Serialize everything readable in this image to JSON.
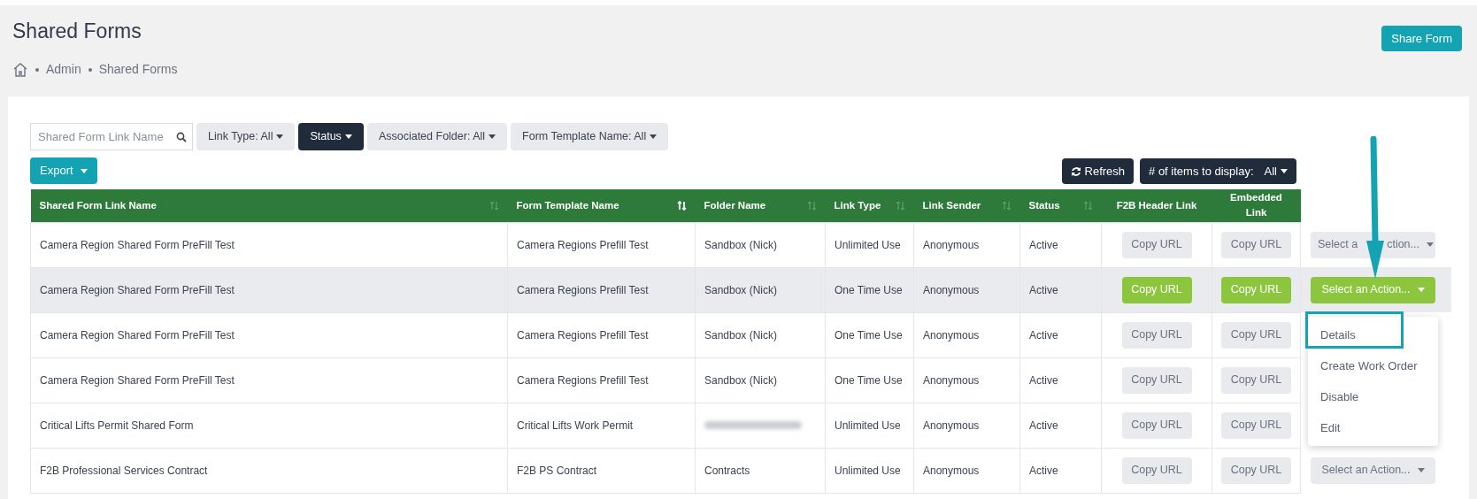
{
  "page": {
    "title": "Shared Forms",
    "primary_button": "Share Form"
  },
  "breadcrumb": [
    "Admin",
    "Shared Forms"
  ],
  "filters": {
    "search": {
      "placeholder": "Shared Form Link Name"
    },
    "dropdowns": [
      {
        "label": "Link Type: All",
        "selected": false
      },
      {
        "label": "Status",
        "selected": true
      },
      {
        "label": "Associated Folder: All",
        "selected": false
      },
      {
        "label": "Form Template Name: All",
        "selected": false
      }
    ]
  },
  "toolbar": {
    "export": "Export",
    "refresh": "Refresh",
    "items_label": "# of items to display:",
    "items_value": "All"
  },
  "table": {
    "columns": [
      {
        "label": "Shared Form Link Name",
        "sortable": true,
        "sorted": false
      },
      {
        "label": "Form Template Name",
        "sortable": true,
        "sorted": true
      },
      {
        "label": "Folder Name",
        "sortable": true,
        "sorted": false
      },
      {
        "label": "Link Type",
        "sortable": true,
        "sorted": false
      },
      {
        "label": "Link Sender",
        "sortable": true,
        "sorted": false
      },
      {
        "label": "Status",
        "sortable": true,
        "sorted": false
      },
      {
        "label": "F2B Header Link",
        "sortable": false
      },
      {
        "label": "Embedded Link",
        "sortable": false
      }
    ],
    "rows": [
      {
        "selected": false,
        "name": "Camera Region Shared Form PreFill Test",
        "template": "Camera Regions Prefill Test",
        "folder": "Sandbox (Nick)",
        "link_type": "Unlimited Use",
        "sender": "Anonymous",
        "status": "Active",
        "header_link": "Copy URL",
        "embedded_link": "Copy URL",
        "action": "Select a",
        "action_tail": "ction..."
      },
      {
        "selected": true,
        "name": "Camera Region Shared Form PreFill Test",
        "template": "Camera Regions Prefill Test",
        "folder": "Sandbox (Nick)",
        "link_type": "One Time Use",
        "sender": "Anonymous",
        "status": "Active",
        "header_link": "Copy URL",
        "embedded_link": "Copy URL",
        "action": "Select an Action..."
      },
      {
        "selected": false,
        "name": "Camera Region Shared Form PreFill Test",
        "template": "Camera Regions Prefill Test",
        "folder": "Sandbox (Nick)",
        "link_type": "One Time Use",
        "sender": "Anonymous",
        "status": "Active",
        "header_link": "Copy URL",
        "embedded_link": "Copy URL"
      },
      {
        "selected": false,
        "name": "Camera Region Shared Form PreFill Test",
        "template": "Camera Regions Prefill Test",
        "folder": "Sandbox (Nick)",
        "link_type": "One Time Use",
        "sender": "Anonymous",
        "status": "Active",
        "header_link": "Copy URL",
        "embedded_link": "Copy URL"
      },
      {
        "selected": false,
        "name": "Critical Lifts Permit Shared Form",
        "template": "Critical Lifts Work Permit",
        "folder_redacted": true,
        "link_type": "Unlimited Use",
        "sender": "Anonymous",
        "status": "Active",
        "header_link": "Copy URL",
        "embedded_link": "Copy URL"
      },
      {
        "selected": false,
        "name": "F2B Professional Services Contract",
        "template": "F2B PS Contract",
        "folder": "Contracts",
        "link_type": "Unlimited Use",
        "sender": "Anonymous",
        "status": "Active",
        "header_link": "Copy URL",
        "embedded_link": "Copy URL",
        "action": "Select an Action..."
      }
    ]
  },
  "action_menu": {
    "items": [
      {
        "label": "Details",
        "selected": true
      },
      {
        "label": "Create Work Order",
        "selected": false
      },
      {
        "label": "Disable",
        "selected": false
      },
      {
        "label": "Edit",
        "selected": false
      }
    ]
  }
}
